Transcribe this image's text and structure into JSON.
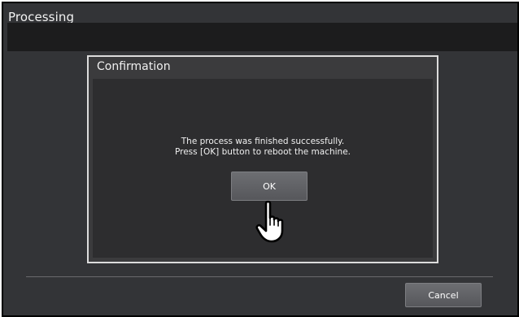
{
  "header": {
    "title": "Processing"
  },
  "dialog": {
    "title": "Confirmation",
    "message_lines": [
      "The process was finished successfully.",
      "Press [OK] button to reboot the machine."
    ],
    "ok_label": "OK"
  },
  "footer": {
    "cancel_label": "Cancel"
  },
  "icons": {
    "pointer": "hand-pointer-icon"
  },
  "colors": {
    "screen_bg": "#333437",
    "header_bar": "#1c1c1d",
    "dialog_border": "#dcdcdc",
    "button_bg": "#606165",
    "text": "#f0f0f0"
  }
}
